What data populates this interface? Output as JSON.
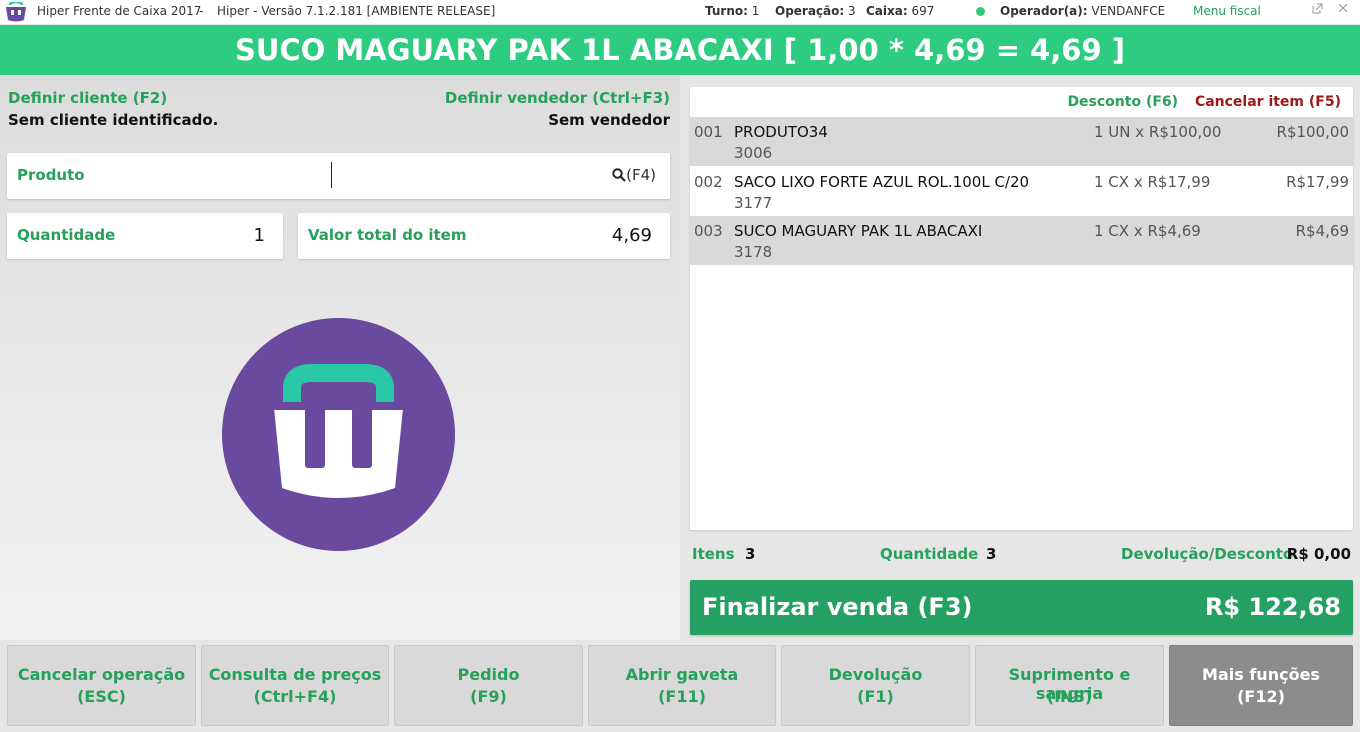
{
  "titlebar": {
    "app_title": "Hiper Frente de Caixa 2017",
    "separator": "-",
    "version": "Hiper - Versão 7.1.2.181 [AMBIENTE RELEASE]",
    "turno_label": "Turno:",
    "turno_value": "1",
    "operacao_label": "Operação:",
    "operacao_value": "3",
    "caixa_label": "Caixa:",
    "caixa_value": "697",
    "operador_label": "Operador(a):",
    "operador_value": "VENDANFCE",
    "menu_fiscal": "Menu fiscal",
    "status_color": "#2ecc71"
  },
  "banner": {
    "text": "SUCO MAGUARY PAK 1L ABACAXI [ 1,00 * 4,69 = 4,69 ]"
  },
  "left": {
    "define_client": "Definir cliente (F2)",
    "client_status": "Sem cliente identificado.",
    "define_seller": "Definir vendedor (Ctrl+F3)",
    "seller_status": "Sem vendedor",
    "product_label": "Produto",
    "product_value": "",
    "search_shortcut": "(F4)",
    "quantity_label": "Quantidade",
    "quantity_value": "1",
    "item_total_label": "Valor total do item",
    "item_total_value": "4,69"
  },
  "items": {
    "discount_action": "Desconto (F6)",
    "cancel_action": "Cancelar item (F5)",
    "rows": [
      {
        "num": "001",
        "name": "PRODUTO34",
        "code": "3006",
        "qty": "1 UN x R$100,00",
        "total": "R$100,00"
      },
      {
        "num": "002",
        "name": "SACO LIXO FORTE AZUL ROL.100L C/20",
        "code": "3177",
        "qty": "1 CX x R$17,99",
        "total": "R$17,99"
      },
      {
        "num": "003",
        "name": "SUCO MAGUARY PAK 1L ABACAXI",
        "code": "3178",
        "qty": "1 CX x R$4,69",
        "total": "R$4,69"
      }
    ]
  },
  "summary": {
    "items_label": "Itens",
    "items_value": "3",
    "quantity_label": "Quantidade",
    "quantity_value": "3",
    "discount_label": "Devolução/Desconto",
    "discount_value": "R$ 0,00"
  },
  "finalize": {
    "label": "Finalizar venda (F3)",
    "value": "R$ 122,68"
  },
  "buttons": [
    {
      "l1": "Cancelar operação",
      "l2": "(ESC)"
    },
    {
      "l1": "Consulta de preços",
      "l2": "(Ctrl+F4)"
    },
    {
      "l1": "Pedido",
      "l2": "(F9)"
    },
    {
      "l1": "Abrir gaveta",
      "l2": "(F11)"
    },
    {
      "l1": "Devolução",
      "l2": "(F1)"
    },
    {
      "l1": "Suprimento e sangria",
      "l2": "(INS)"
    },
    {
      "l1": "Mais funções",
      "l2": "(F12)"
    }
  ],
  "colors": {
    "brand_green": "#2ecc81",
    "accent_green": "#27a05a",
    "finalize_green": "#25a063",
    "logo_purple": "#6a4a9e",
    "logo_teal": "#29c9a8",
    "cancel_red": "#a01818"
  },
  "icons": {
    "app_logo": "basket-icon",
    "search": "search-icon",
    "popout": "popout-icon",
    "close": "close-icon"
  }
}
